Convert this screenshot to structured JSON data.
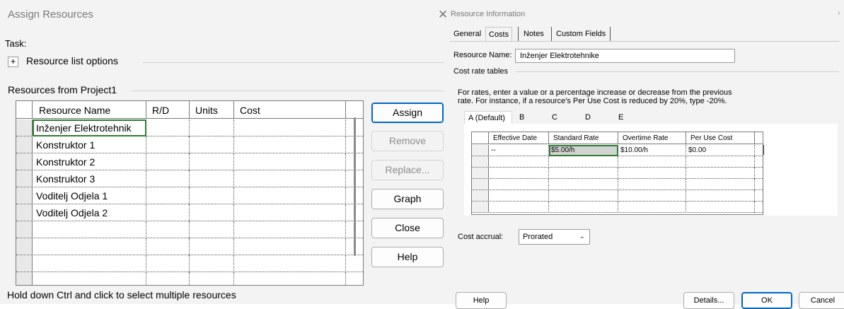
{
  "assign": {
    "title": "Assign Resources",
    "task_label": "Task:",
    "options_label": "Resource list options",
    "plus": "+",
    "resources_from": "Resources from Project1",
    "columns": [
      "Resource Name",
      "R/D",
      "Units",
      "Cost"
    ],
    "rows": [
      {
        "name": "Inženjer Elektrotehnik",
        "rd": "",
        "units": "",
        "cost": ""
      },
      {
        "name": "Konstruktor 1",
        "rd": "",
        "units": "",
        "cost": ""
      },
      {
        "name": "Konstruktor 2",
        "rd": "",
        "units": "",
        "cost": ""
      },
      {
        "name": "Konstruktor 3",
        "rd": "",
        "units": "",
        "cost": ""
      },
      {
        "name": "Voditelj Odjela 1",
        "rd": "",
        "units": "",
        "cost": ""
      },
      {
        "name": "Voditelj Odjela 2",
        "rd": "",
        "units": "",
        "cost": ""
      },
      {
        "name": "",
        "rd": "",
        "units": "",
        "cost": ""
      },
      {
        "name": "",
        "rd": "",
        "units": "",
        "cost": ""
      },
      {
        "name": "",
        "rd": "",
        "units": "",
        "cost": ""
      },
      {
        "name": "",
        "rd": "",
        "units": "",
        "cost": ""
      }
    ],
    "buttons": {
      "assign": "Assign",
      "remove": "Remove",
      "replace": "Replace...",
      "graph": "Graph",
      "close": "Close",
      "help": "Help"
    },
    "hint": "Hold down Ctrl and click to select multiple resources"
  },
  "resource_info": {
    "title": "Resource Information",
    "close_glyph": "✕",
    "more_glyph": "›",
    "tabs": [
      "General",
      "Costs",
      "Notes",
      "Custom Fields"
    ],
    "active_tab": "Costs",
    "resource_name_label": "Resource Name:",
    "resource_name_value": "Inženjer Elektrotehnike",
    "cost_rate_tables": "Cost rate tables",
    "instructions": [
      "For rates, enter a value or a percentage increase or decrease from the previous",
      "rate. For instance, if a resource's Per Use Cost is reduced by 20%, type -20%."
    ],
    "rate_tabs": [
      "A (Default)",
      "B",
      "C",
      "D",
      "E"
    ],
    "rate_columns": [
      "Effective Date",
      "Standard Rate",
      "Overtime Rate",
      "Per Use Cost"
    ],
    "rate_rows": [
      {
        "date": "--",
        "std": "$5.00/h",
        "ot": "$10.00/h",
        "per_use": "$0.00"
      },
      {
        "date": "",
        "std": "",
        "ot": "",
        "per_use": ""
      },
      {
        "date": "",
        "std": "",
        "ot": "",
        "per_use": ""
      },
      {
        "date": "",
        "std": "",
        "ot": "",
        "per_use": ""
      },
      {
        "date": "",
        "std": "",
        "ot": "",
        "per_use": ""
      },
      {
        "date": "",
        "std": "",
        "ot": "",
        "per_use": ""
      }
    ],
    "cost_accrual_label": "Cost accrual:",
    "cost_accrual_value": "Prorated",
    "buttons": {
      "help": "Help",
      "details": "Details...",
      "ok": "OK",
      "cancel": "Cancel"
    }
  },
  "colors": {
    "dialog_bg": "#f3f3f3",
    "selection_border": "#2e7d32",
    "primary_button_border": "#0067c0",
    "disabled_text": "#8d8d8d"
  }
}
